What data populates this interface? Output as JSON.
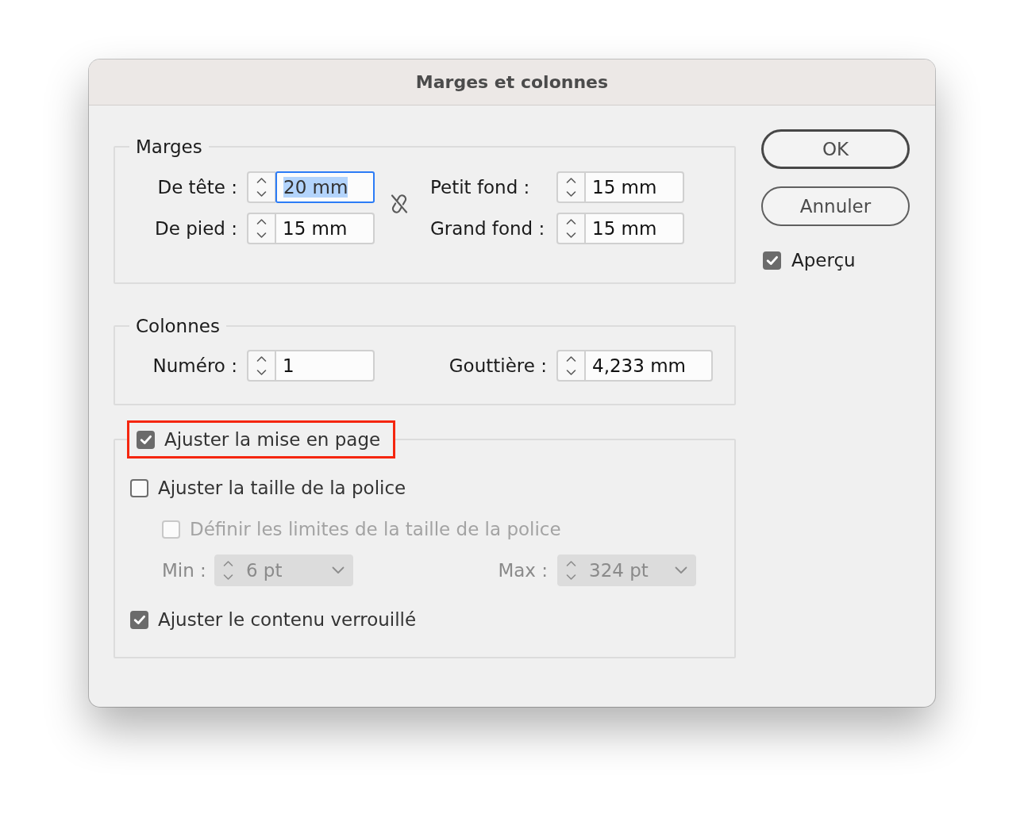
{
  "window": {
    "title": "Marges et colonnes"
  },
  "margins": {
    "title": "Marges",
    "linked": false,
    "fields": [
      {
        "label": "De tête :",
        "value": "20 mm",
        "focused": true
      },
      {
        "label": "Petit fond :",
        "value": "15 mm",
        "focused": false
      },
      {
        "label": "De pied :",
        "value": "15 mm",
        "focused": false
      },
      {
        "label": "Grand fond :",
        "value": "15 mm",
        "focused": false
      }
    ]
  },
  "columns": {
    "title": "Colonnes",
    "fields": [
      {
        "label": "Numéro :",
        "value": "1",
        "focused": false
      },
      {
        "label": "Gouttière :",
        "value": "4,233 mm",
        "focused": false
      }
    ]
  },
  "layout_adjust": {
    "label": "Ajuster la mise en page",
    "checked": true,
    "highlighted": true,
    "options": [
      {
        "kind": "checkbox",
        "label": "Ajuster la taille de la police",
        "checked": false,
        "disabled": false,
        "children": [
          {
            "kind": "checkbox",
            "label": "Définir les limites de la taille de la police",
            "checked": false,
            "disabled": true
          },
          {
            "kind": "range",
            "disabled": true,
            "min": {
              "label": "Min :",
              "value": "6 pt"
            },
            "max": {
              "label": "Max :",
              "value": "324 pt"
            }
          }
        ]
      },
      {
        "kind": "checkbox",
        "label": "Ajuster le contenu verrouillé",
        "checked": true,
        "disabled": false
      }
    ]
  },
  "buttons": [
    {
      "label": "OK",
      "default": true
    },
    {
      "label": "Annuler",
      "default": false
    }
  ],
  "preview": {
    "label": "Aperçu",
    "checked": true
  }
}
